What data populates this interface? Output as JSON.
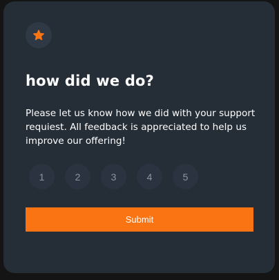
{
  "card": {
    "icon": "star-icon",
    "title": "how did we do?",
    "description": "Please let us know how we did with your support requiest. All feedback is appreciated to help us improve our offering!",
    "ratings": [
      "1",
      "2",
      "3",
      "4",
      "5"
    ],
    "submit_label": "Submit"
  },
  "colors": {
    "page_background": "#141414",
    "card_background": "#252d37",
    "rating_background": "#2a333f",
    "accent": "#fb7413",
    "text_primary": "#ffffff",
    "text_muted": "#8d96a3"
  }
}
